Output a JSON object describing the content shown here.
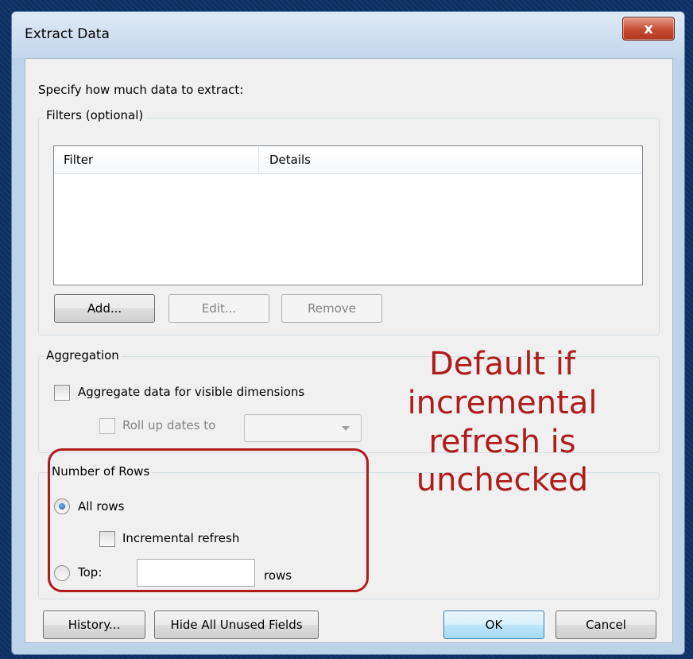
{
  "window": {
    "title": "Extract Data",
    "close_label": "x"
  },
  "prompt": "Specify how much data to extract:",
  "filters": {
    "legend": "Filters (optional)",
    "columns": [
      "Filter",
      "Details"
    ],
    "rows": [],
    "add_label": "Add...",
    "edit_label": "Edit...",
    "remove_label": "Remove"
  },
  "aggregation": {
    "legend": "Aggregation",
    "aggregate_label": "Aggregate data for visible dimensions",
    "aggregate_checked": false,
    "rollup_label": "Roll up dates to",
    "rollup_value": ""
  },
  "rows": {
    "legend": "Number of Rows",
    "all_rows_label": "All rows",
    "all_rows_selected": true,
    "incremental_label": "Incremental refresh",
    "incremental_checked": false,
    "top_label": "Top:",
    "top_value": "",
    "rows_suffix": "rows"
  },
  "footer": {
    "history_label": "History...",
    "hide_unused_label": "Hide All Unused Fields",
    "ok_label": "OK",
    "cancel_label": "Cancel"
  },
  "annotation": {
    "lines": [
      "Default if",
      "incremental",
      "refresh is",
      "unchecked"
    ],
    "color": "#b01c1c"
  }
}
